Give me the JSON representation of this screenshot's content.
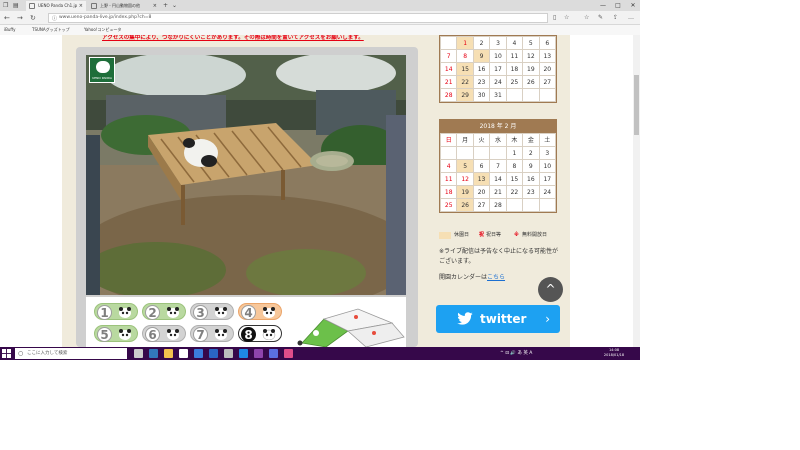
{
  "browser": {
    "tabs": [
      {
        "label": "UENO Panda Ch1.jp",
        "active": true
      },
      {
        "label": "上野 - 円山動物園の他"
      }
    ],
    "url": "www.ueno-panda-live.jp/index.php?ch=8",
    "favorites": [
      {
        "label": "iBuffy"
      },
      {
        "label": "TSUNAグッズトップ"
      },
      {
        "label": "Yahoo!コンピュータ"
      }
    ],
    "window_controls": [
      "—",
      "□",
      "✕"
    ]
  },
  "page": {
    "notice": "アクセスの集中により、つながりにくいことがあります。その際は時間を置いてアクセスをお願いします。",
    "logo_text": "UENO PANDA",
    "camera_buttons": [
      {
        "num": "1",
        "style": "green"
      },
      {
        "num": "2",
        "style": "green"
      },
      {
        "num": "3",
        "style": "gray"
      },
      {
        "num": "4",
        "style": "orange"
      },
      {
        "num": "5",
        "style": "green"
      },
      {
        "num": "6",
        "style": "gray"
      },
      {
        "num": "7",
        "style": "gray"
      },
      {
        "num": "8",
        "style": "active"
      }
    ]
  },
  "calendar_jan": {
    "rows": [
      [
        "",
        "1",
        "2",
        "3",
        "4",
        "5",
        "6"
      ],
      [
        "7",
        "8",
        "9",
        "10",
        "11",
        "12",
        "13"
      ],
      [
        "14",
        "15",
        "16",
        "17",
        "18",
        "19",
        "20"
      ],
      [
        "21",
        "22",
        "23",
        "24",
        "25",
        "26",
        "27"
      ],
      [
        "28",
        "29",
        "30",
        "31",
        "",
        "",
        ""
      ]
    ],
    "holidays": [
      "1",
      "9",
      "15",
      "22",
      "29"
    ],
    "red": [
      "1",
      "8"
    ]
  },
  "calendar_feb": {
    "title": "2018 年 2 月",
    "weekdays": [
      "日",
      "月",
      "火",
      "水",
      "木",
      "金",
      "土"
    ],
    "rows": [
      [
        "",
        "",
        "",
        "",
        "1",
        "2",
        "3"
      ],
      [
        "4",
        "5",
        "6",
        "7",
        "8",
        "9",
        "10"
      ],
      [
        "11",
        "12",
        "13",
        "14",
        "15",
        "16",
        "17"
      ],
      [
        "18",
        "19",
        "20",
        "21",
        "22",
        "23",
        "24"
      ],
      [
        "25",
        "26",
        "27",
        "28",
        "",
        "",
        ""
      ]
    ],
    "holidays": [
      "5",
      "13",
      "19",
      "26"
    ],
    "red": [
      "12"
    ]
  },
  "legend": {
    "closed": "休園日",
    "holiday_icon": "祝",
    "holiday": "祝日等",
    "free_icon": "※",
    "free": "無料開放日"
  },
  "note": "※ライブ配信は予告なく中止になる可能性がございます。",
  "calendar_link": {
    "prefix": "開園カレンダーは",
    "link": "こちら"
  },
  "twitter": {
    "label": "twitter",
    "arrow": "›"
  },
  "up_arrow": "^",
  "taskbar": {
    "search_placeholder": "ここに入力して検索",
    "tray": "^ ⊡ 🔊 あ 英 A",
    "time": "14:08",
    "date": "2018/01/18",
    "icons": [
      {
        "name": "task-view-icon",
        "color": "#cccccc"
      },
      {
        "name": "edge-icon",
        "color": "#3277bc"
      },
      {
        "name": "explorer-icon",
        "color": "#f2c14e"
      },
      {
        "name": "store-icon",
        "color": "#ffffff"
      },
      {
        "name": "calendar-icon",
        "color": "#3b7ddd"
      },
      {
        "name": "outlook-icon",
        "color": "#2a66c5"
      },
      {
        "name": "settings-icon",
        "color": "#bdbdbd"
      },
      {
        "name": "edge2-icon",
        "color": "#1e88e5"
      },
      {
        "name": "media-icon",
        "color": "#8e44ad"
      },
      {
        "name": "tv-icon",
        "color": "#5b6ee1"
      },
      {
        "name": "app-icon",
        "color": "#e04e8a"
      }
    ]
  }
}
